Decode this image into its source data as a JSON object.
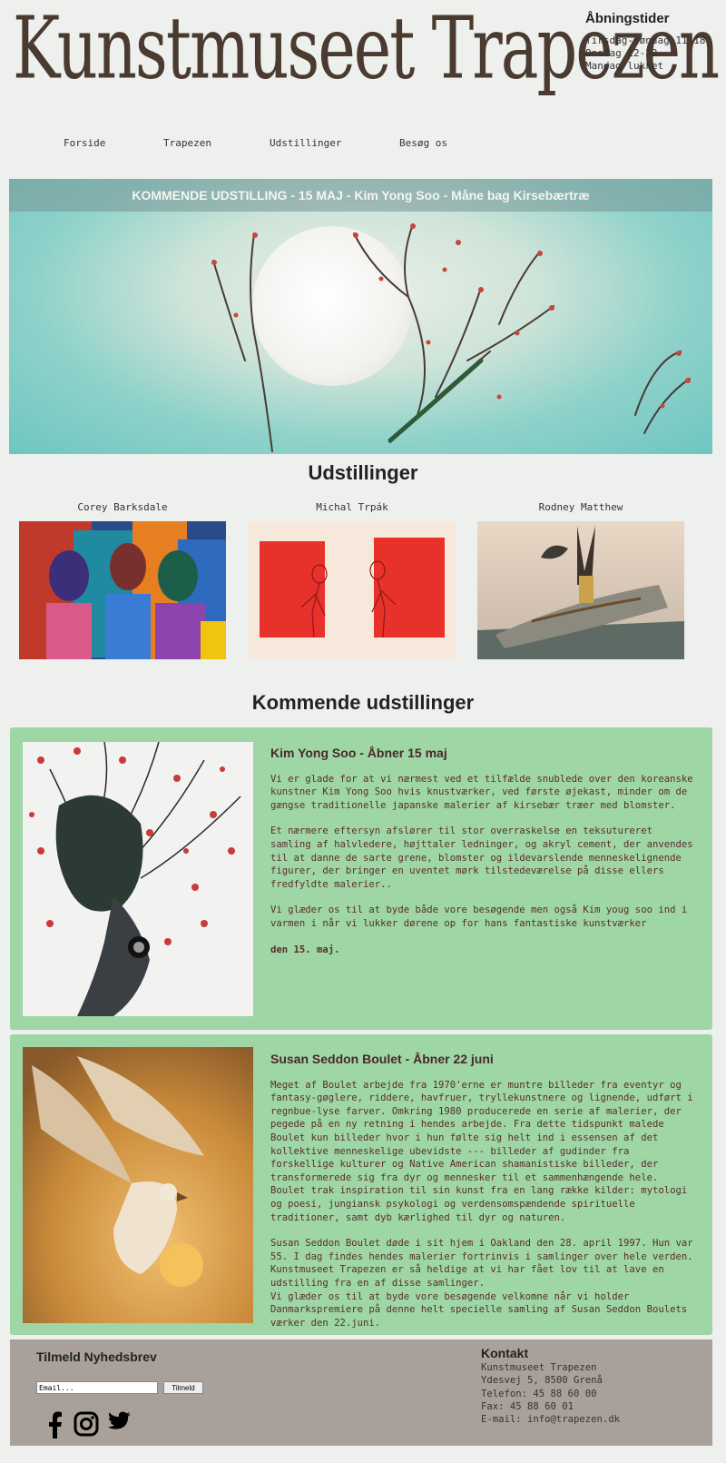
{
  "header": {
    "logo": "Kunstmuseet Trapezen",
    "hours_title": "Åbningstider",
    "hours_lines": [
      "Tirsdag-søndag 11-18",
      "Onsdag 12-22",
      "Mandag lukket"
    ]
  },
  "nav": [
    "Forside",
    "Trapezen",
    "Udstillinger",
    "Besøg os"
  ],
  "hero": {
    "caption": "KOMMENDE UDSTILLING - 15 MAJ - Kim Yong Soo - Måne bag Kirsebærtræ"
  },
  "exhibitions": {
    "title": "Udstillinger",
    "items": [
      {
        "artist": "Corey Barksdale"
      },
      {
        "artist": "Michal Trpák"
      },
      {
        "artist": "Rodney Matthew"
      }
    ]
  },
  "upcoming": {
    "title": "Kommende udstillinger",
    "cards": [
      {
        "heading": "Kim Yong Soo - Åbner 15 maj",
        "paragraphs": [
          "Vi er glade for at vi nærmest ved et tilfælde snublede over den koreanske kunstner Kim Yong Soo hvis knustværker, ved første øjekast, minder om de gængse traditionelle japanske malerier af kirsebær træer med blomster.",
          "Et nærmere eftersyn afslører til stor overraskelse en teksutureret samling af halvledere, højttaler ledninger, og akryl cement, der anvendes til at danne de sarte grene, blomster og ildevarslende menneskelignende figurer, der bringer en uventet mørk tilstedeværelse på disse ellers fredfyldte malerier..",
          "Vi glæder os til at byde både vore besøgende men også Kim youg soo ind i varmen i når vi lukker dørene op for hans fantastiske kunstværker",
          "den 15. maj."
        ]
      },
      {
        "heading": "Susan Seddon Boulet - Åbner 22 juni",
        "paragraphs": [
          "Meget af Boulet arbejde fra 1970'erne er muntre billeder fra eventyr og fantasy-gøglere, riddere, havfruer, tryllekunstnere og lignende, udført i regnbue-lyse farver. Omkring 1980 producerede en serie af malerier, der pegede på en ny retning i hendes arbejde. Fra dette tidspunkt malede Boulet kun billeder hvor i hun følte sig helt ind i essensen af det kollektive menneskelige ubevidste --- billeder af gudinder fra forskellige kulturer og Native American shamanistiske billeder, der transformerede sig fra dyr og mennesker til et sammenhængende hele. Boulet trak inspiration til sin kunst fra en lang række kilder: mytologi og poesi, jungiansk psykologi og verdensomspændende spirituelle traditioner, samt dyb kærlighed til dyr og naturen.",
          "Susan Seddon Boulet døde i sit hjem i Oakland den 28. april 1997. Hun var 55. I dag findes hendes malerier fortrinvis i samlinger over hele verden. Kunstmuseet Trapezen er så heldige at vi har fået lov til at lave en udstilling fra en af disse samlinger.\nVi glæder os til at byde vore besøgende velkomne når vi holder Danmarkspremiere på denne helt specielle samling af Susan Seddon Boulets værker den 22.juni."
        ]
      }
    ]
  },
  "footer": {
    "newsletter_title": "Tilmeld Nyhedsbrev",
    "email_value": "Email...",
    "subscribe_label": "Tilmeld",
    "contact_title": "Kontakt",
    "contact_lines": [
      "Kunstmuseet Trapezen",
      "Ydesvej 5, 8500 Grenå",
      "Telefon: 45 88 60 00",
      "Fax: 45 88 60 01",
      "E-mail: info@trapezen.dk"
    ],
    "social": [
      "facebook-icon",
      "instagram-icon",
      "twitter-icon"
    ]
  }
}
